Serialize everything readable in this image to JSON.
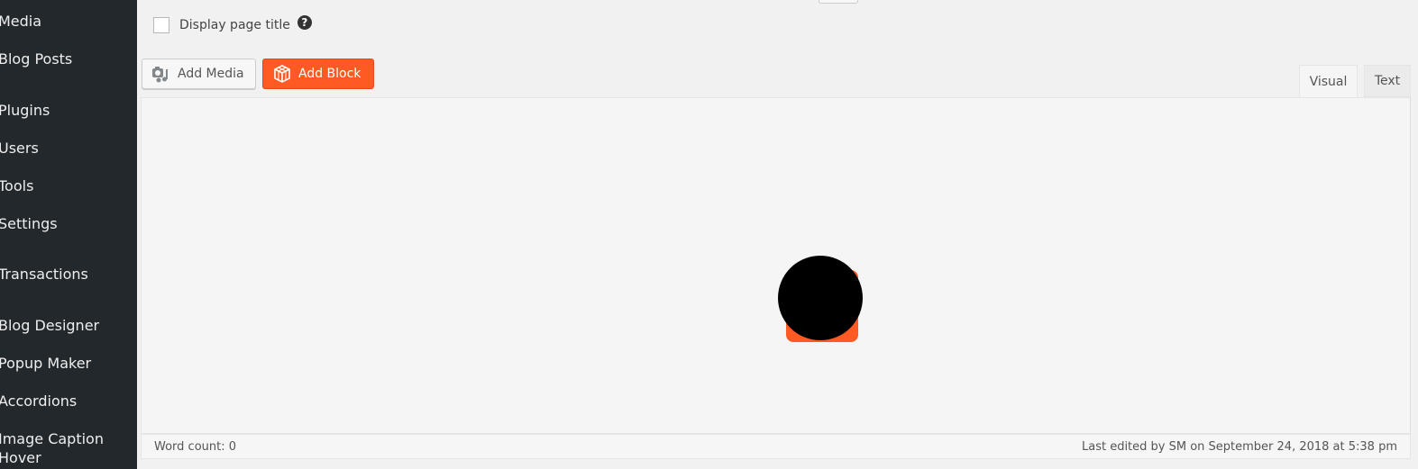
{
  "sidebar": {
    "items": [
      {
        "label": "Media"
      },
      {
        "label": "Blog Posts"
      },
      {
        "label": "Plugins"
      },
      {
        "label": "Users"
      },
      {
        "label": "Tools"
      },
      {
        "label": "Settings"
      },
      {
        "label": "Transactions"
      },
      {
        "label": "Blog Designer"
      },
      {
        "label": "Popup Maker"
      },
      {
        "label": "Accordions"
      },
      {
        "label": "Image Caption Hover"
      }
    ]
  },
  "page_options": {
    "display_title_label": "Display page title",
    "display_title_checked": false,
    "help_icon": "?"
  },
  "toolbar": {
    "add_media_label": "Add Media",
    "add_block_label": "Add Block"
  },
  "tabs": {
    "visual": "Visual",
    "text": "Text",
    "active": "Visual"
  },
  "status": {
    "word_count": "Word count: 0",
    "last_edited": "Last edited by SM on September 24, 2018 at 5:38 pm"
  },
  "colors": {
    "accent": "#ff5a23",
    "sidebar_bg": "#23282d"
  }
}
